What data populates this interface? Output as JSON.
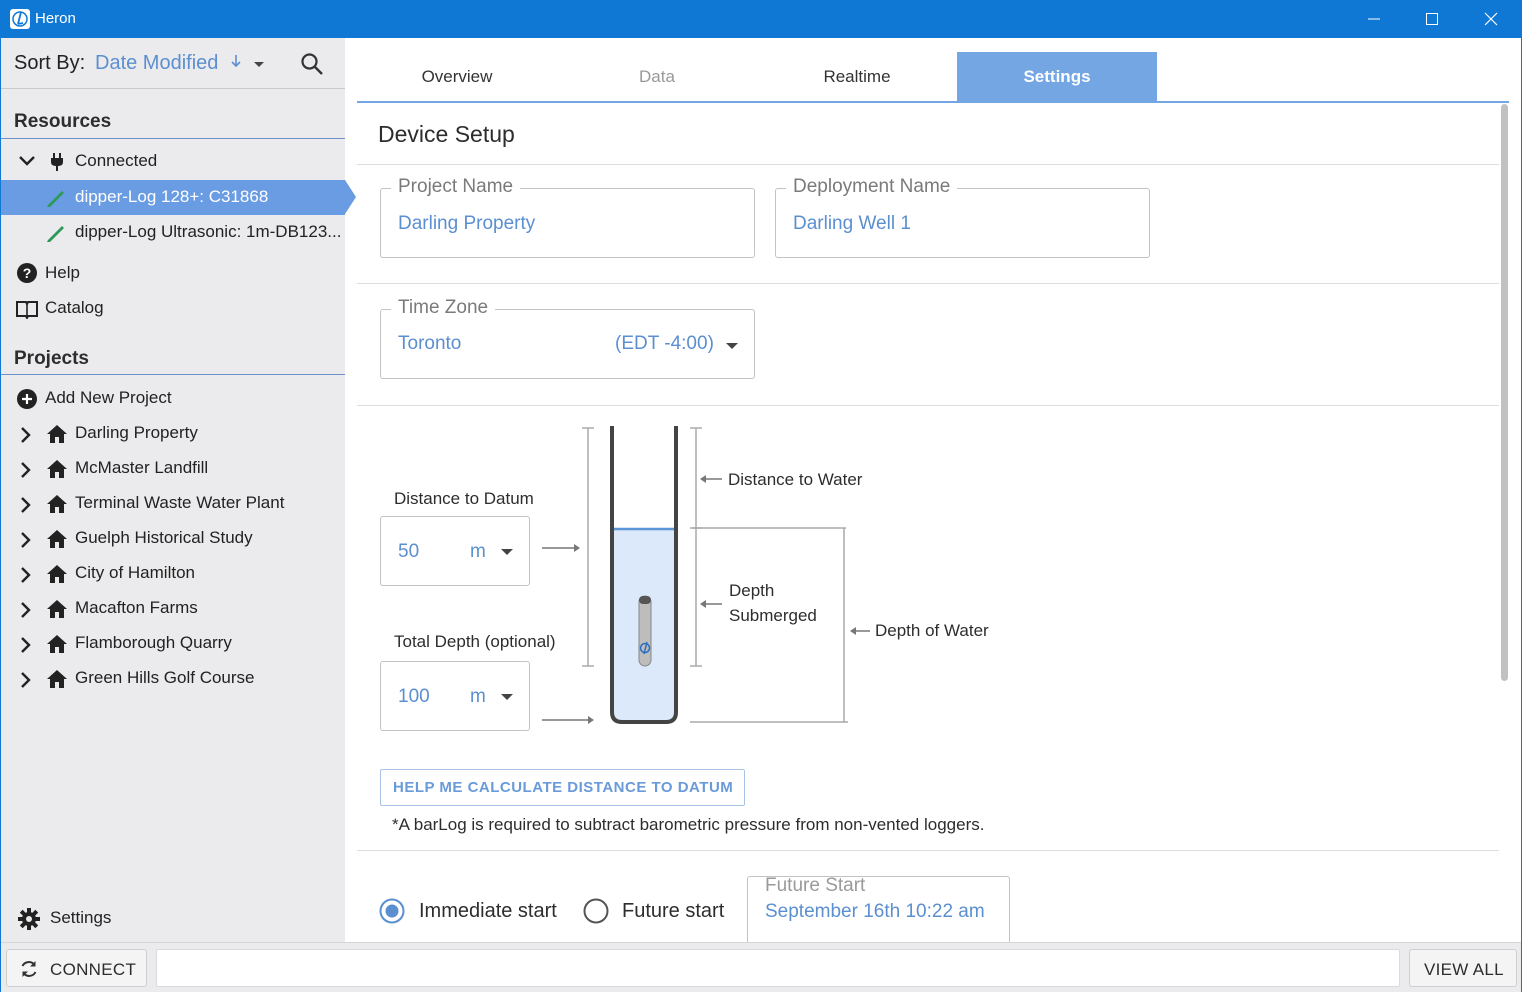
{
  "window": {
    "title": "Heron"
  },
  "sidebar": {
    "sort_label": "Sort By:",
    "sort_value": "Date Modified",
    "resources_title": "Resources",
    "resources": [
      {
        "label": "Connected",
        "icon": "plug-icon"
      },
      {
        "label": "dipper-Log 128+: C31868",
        "icon": "pencil-icon",
        "selected": true
      },
      {
        "label": "dipper-Log Ultrasonic: 1m-DB123...",
        "icon": "pencil-icon"
      },
      {
        "label": "Help",
        "icon": "help-icon"
      },
      {
        "label": "Catalog",
        "icon": "book-icon"
      }
    ],
    "projects_title": "Projects",
    "add_project": "Add New Project",
    "projects": [
      "Darling Property",
      "McMaster Landfill",
      "Terminal Waste Water Plant",
      "Guelph Historical Study",
      "City of Hamilton",
      "Macafton Farms",
      "Flamborough Quarry",
      "Green Hills Golf Course"
    ],
    "settings_label": "Settings"
  },
  "bottombar": {
    "connect_label": "CONNECT",
    "view_all_label": "VIEW ALL"
  },
  "tabs": [
    {
      "label": "Overview",
      "state": "normal"
    },
    {
      "label": "Data",
      "state": "disabled"
    },
    {
      "label": "Realtime",
      "state": "normal"
    },
    {
      "label": "Settings",
      "state": "active"
    }
  ],
  "device_setup": {
    "title": "Device Setup",
    "project_name": {
      "legend": "Project Name",
      "value": "Darling Property"
    },
    "deployment_name": {
      "legend": "Deployment Name",
      "value": "Darling Well 1"
    },
    "time_zone": {
      "legend": "Time Zone",
      "value": "Toronto",
      "offset": "(EDT -4:00)"
    },
    "distance_to_datum": {
      "label": "Distance to Datum",
      "value": "50",
      "unit": "m"
    },
    "total_depth": {
      "label": "Total Depth (optional)",
      "value": "100",
      "unit": "m"
    },
    "diagram_labels": {
      "distance_to_water": "Distance to Water",
      "depth_submerged_1": "Depth",
      "depth_submerged_2": "Submerged",
      "depth_of_water": "Depth of Water"
    },
    "help_button": "HELP ME CALCULATE DISTANCE TO DATUM",
    "note": "*A barLog is required to subtract barometric pressure from non-vented loggers.",
    "start": {
      "immediate_label": "Immediate start",
      "future_label": "Future start",
      "selected": "immediate",
      "future_start": {
        "legend": "Future Start",
        "value": "September 16th 10:22 am"
      }
    }
  },
  "colors": {
    "titlebar": "#0f78d4",
    "accent": "#5b8fd0",
    "selection": "#6a9ce3",
    "tab_active": "#75a6e4",
    "sidebar_bg": "#ebebed"
  }
}
